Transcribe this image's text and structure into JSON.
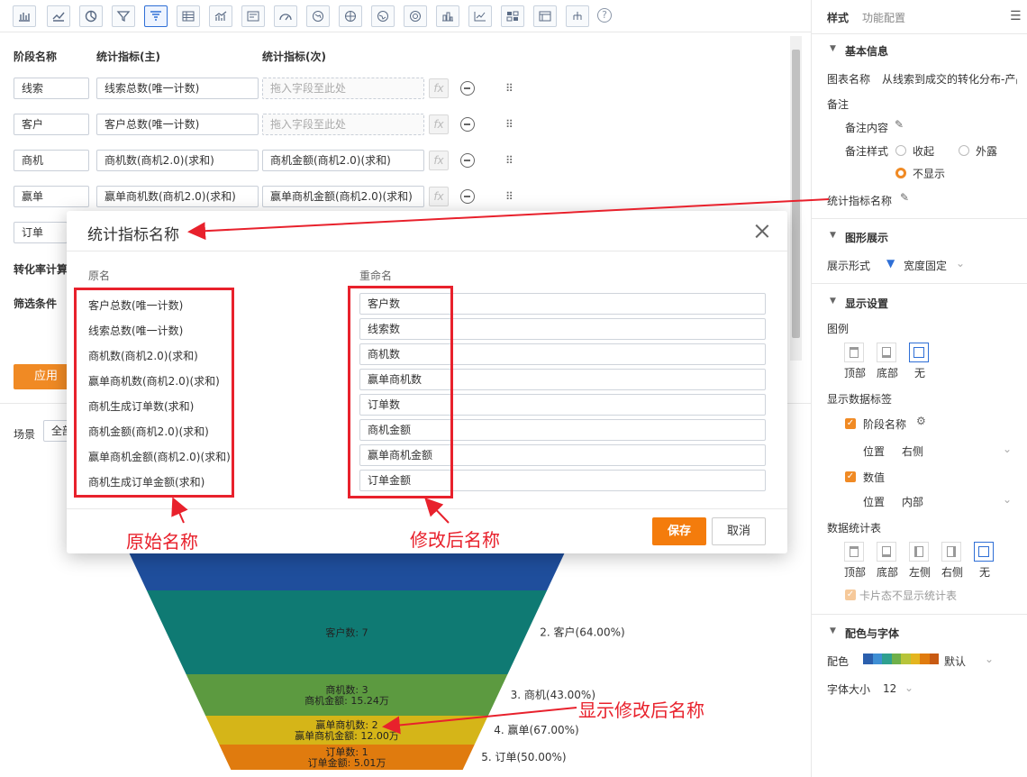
{
  "toolbar": {
    "icons": [
      "bar-chart-icon",
      "line-chart-icon",
      "pie-chart-icon",
      "funnel-icon",
      "funnel-active-icon",
      "table-icon",
      "combo-chart-icon",
      "card-icon",
      "gauge-icon",
      "map-icon",
      "globe-icon",
      "region-map-icon",
      "radar-icon",
      "histogram-icon",
      "scatter-icon",
      "heatmap-icon",
      "pivot-table-icon",
      "tree-icon",
      "help-icon"
    ]
  },
  "config": {
    "headers": {
      "stage": "阶段名称",
      "primary": "统计指标(主)",
      "secondary": "统计指标(次)"
    },
    "rows": [
      {
        "stage": "线索",
        "primary": "线索总数(唯一计数)",
        "secondary": "拖入字段至此处",
        "secondary_empty": true
      },
      {
        "stage": "客户",
        "primary": "客户总数(唯一计数)",
        "secondary": "拖入字段至此处",
        "secondary_empty": true
      },
      {
        "stage": "商机",
        "primary": "商机数(商机2.0)(求和)",
        "secondary": "商机金额(商机2.0)(求和)",
        "secondary_empty": false
      },
      {
        "stage": "赢单",
        "primary": "赢单商机数(商机2.0)(求和)",
        "secondary": "赢单商机金额(商机2.0)(求和)",
        "secondary_empty": false
      },
      {
        "stage": "订单",
        "primary": "",
        "secondary": "",
        "secondary_empty": false
      }
    ],
    "fx_label": "fx",
    "conversion_label": "转化率计算",
    "filter_label": "筛选条件",
    "apply_label": "应用",
    "scene_label": "场景",
    "scene_value": "全部"
  },
  "modal": {
    "title": "统计指标名称",
    "col_original": "原名",
    "col_rename": "重命名",
    "items": [
      {
        "original": "客户总数(唯一计数)",
        "rename": "客户数"
      },
      {
        "original": "线索总数(唯一计数)",
        "rename": "线索数"
      },
      {
        "original": "商机数(商机2.0)(求和)",
        "rename": "商机数"
      },
      {
        "original": "赢单商机数(商机2.0)(求和)",
        "rename": "赢单商机数"
      },
      {
        "original": "商机生成订单数(求和)",
        "rename": "订单数"
      },
      {
        "original": "商机金额(商机2.0)(求和)",
        "rename": "商机金额"
      },
      {
        "original": "赢单商机金额(商机2.0)(求和)",
        "rename": "赢单商机金额"
      },
      {
        "original": "商机生成订单金额(求和)",
        "rename": "订单金额"
      }
    ],
    "save_label": "保存",
    "cancel_label": "取消"
  },
  "annotations": {
    "original_names": "原始名称",
    "modified_names": "修改后名称",
    "show_modified": "显示修改后名称",
    "color": "#e8212c"
  },
  "funnel": {
    "colors": [
      "#1f4e9c",
      "#0f7a73",
      "#5c9a40",
      "#d5b518",
      "#e07b0e"
    ],
    "segments": [
      {
        "labels": []
      },
      {
        "labels": [
          "客户数: 7"
        ],
        "side": "2. 客户(64.00%)"
      },
      {
        "labels": [
          "商机数: 3",
          "商机金额: 15.24万"
        ],
        "side": "3. 商机(43.00%)"
      },
      {
        "labels": [
          "赢单商机数: 2",
          "赢单商机金额: 12.00万"
        ],
        "side": "4. 赢单(67.00%)"
      },
      {
        "labels": [
          "订单数: 1",
          "订单金额: 5.01万"
        ],
        "side": "5. 订单(50.00%)"
      }
    ]
  },
  "right_panel": {
    "tab_style": "样式",
    "tab_function": "功能配置",
    "basic_info": "基本信息",
    "chart_name_label": "图表名称",
    "chart_name_value": "从线索到成交的转化分布-产品",
    "remark_label": "备注",
    "remark_content_label": "备注内容",
    "remark_style_label": "备注样式",
    "remark_opt_collapse": "收起",
    "remark_opt_expose": "外露",
    "remark_opt_hide": "不显示",
    "metric_name_label": "统计指标名称",
    "graphic_display": "图形展示",
    "display_form_label": "展示形式",
    "display_form_value": "宽度固定",
    "display_settings": "显示设置",
    "legend_label": "图例",
    "legend_top": "顶部",
    "legend_bottom": "底部",
    "legend_none": "无",
    "data_label_title": "显示数据标签",
    "stage_name_chk": "阶段名称",
    "position_label": "位置",
    "position_right": "右侧",
    "value_chk": "数值",
    "position_inner": "内部",
    "stat_table_title": "数据统计表",
    "st_top": "顶部",
    "st_bottom": "底部",
    "st_left": "左侧",
    "st_right": "右侧",
    "st_none": "无",
    "card_state_hint": "卡片态不显示统计表",
    "color_font": "配色与字体",
    "color_label": "配色",
    "color_value": "默认",
    "palette": [
      "#2b5fad",
      "#3f8fd4",
      "#2fa08f",
      "#6fb04a",
      "#b7c43a",
      "#e4b51f",
      "#e07b0e",
      "#c85a12"
    ],
    "font_size_label": "字体大小",
    "font_size_value": "12"
  }
}
